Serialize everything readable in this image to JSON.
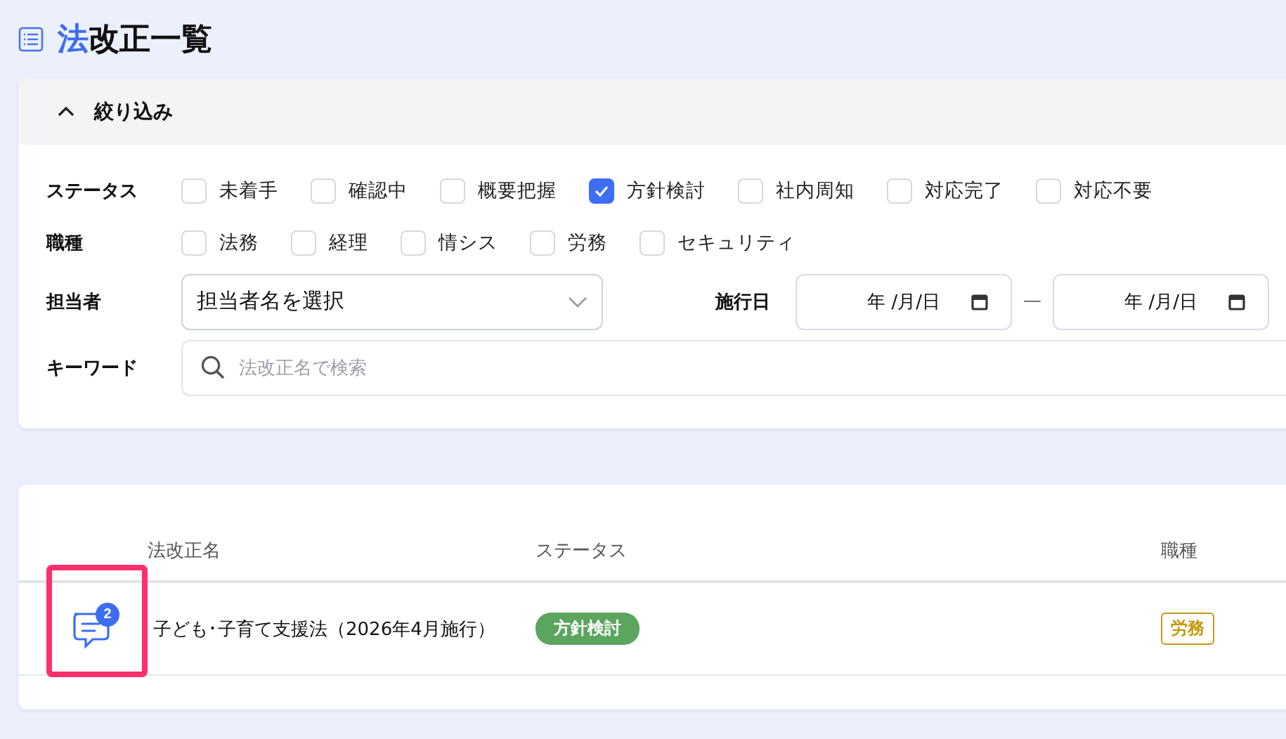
{
  "page_title": {
    "accent": "法",
    "text": "改正一覧"
  },
  "filter": {
    "title": "絞り込み",
    "expanded": true,
    "status_label": "ステータス",
    "statuses": [
      {
        "label": "未着手",
        "checked": false
      },
      {
        "label": "確認中",
        "checked": false
      },
      {
        "label": "概要把握",
        "checked": false
      },
      {
        "label": "方針検討",
        "checked": true
      },
      {
        "label": "社内周知",
        "checked": false
      },
      {
        "label": "対応完了",
        "checked": false
      },
      {
        "label": "対応不要",
        "checked": false
      }
    ],
    "job_label": "職種",
    "jobs": [
      {
        "label": "法務",
        "checked": false
      },
      {
        "label": "経理",
        "checked": false
      },
      {
        "label": "情シス",
        "checked": false
      },
      {
        "label": "労務",
        "checked": false
      },
      {
        "label": "セキュリティ",
        "checked": false
      }
    ],
    "assignee_label": "担当者",
    "assignee_placeholder": "担当者名を選択",
    "date_label": "施行日",
    "date_from": "年 /月/日",
    "date_separator": "—",
    "date_to": "年 /月/日",
    "keyword_label": "キーワード",
    "keyword_placeholder": "法改正名で検索"
  },
  "table": {
    "columns": [
      "法改正名",
      "ステータス",
      "職種"
    ],
    "rows": [
      {
        "comment_count": "2",
        "highlighted": true,
        "name": "子ども･子育て支援法（2026年4月施行）",
        "status": {
          "label": "方針検討",
          "color": "#5ba55f"
        },
        "job": {
          "label": "労務",
          "color": "#c49a12"
        }
      }
    ]
  }
}
